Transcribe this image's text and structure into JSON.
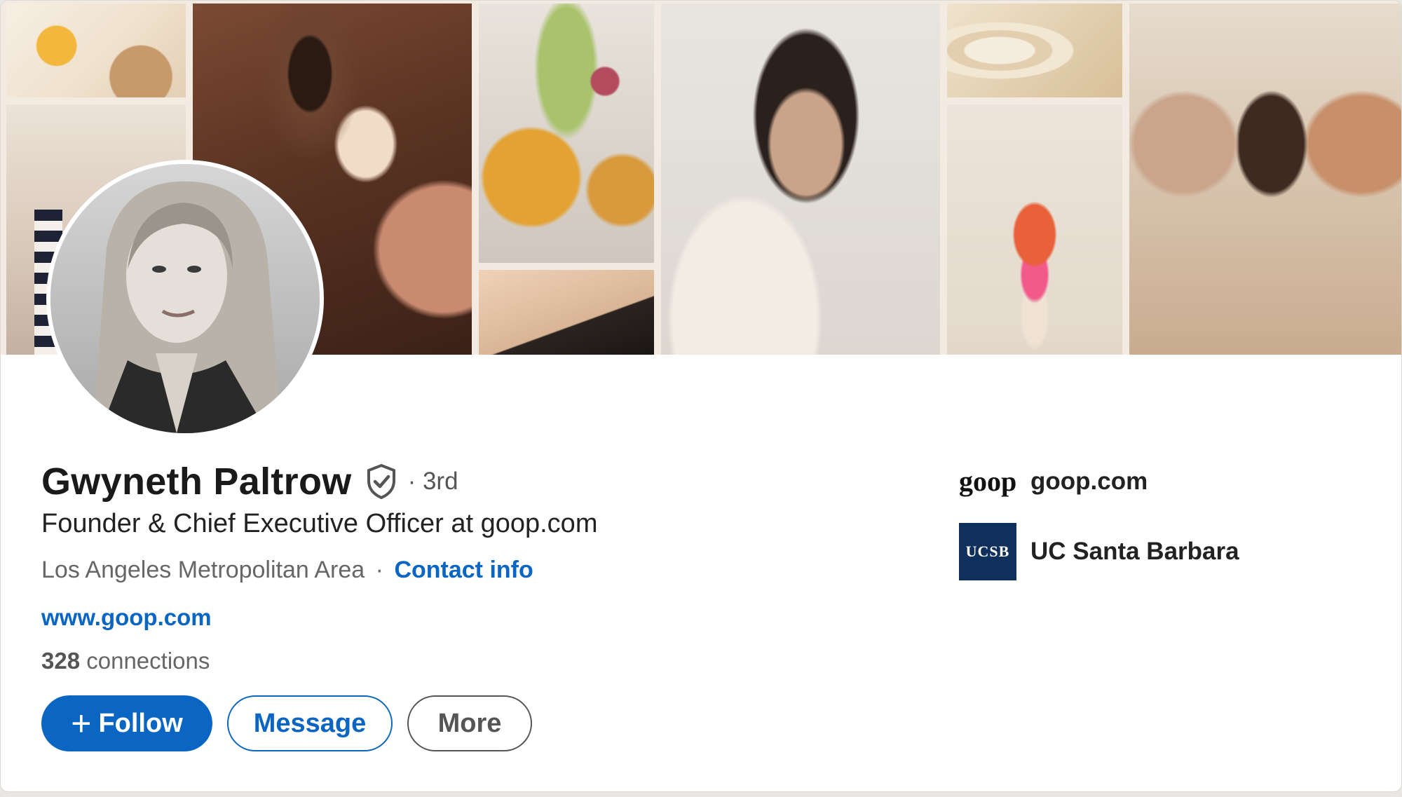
{
  "profile": {
    "name": "Gwyneth Paltrow",
    "degree": "· 3rd",
    "headline": "Founder & Chief Executive Officer at goop.com",
    "location": "Los Angeles Metropolitan Area",
    "location_separator": "·",
    "contact_info_label": "Contact info",
    "website": "www.goop.com",
    "connections_count": "328",
    "connections_label": "connections"
  },
  "actions": {
    "follow_plus": "+",
    "follow_label": "Follow",
    "message_label": "Message",
    "more_label": "More"
  },
  "organizations": [
    {
      "logo_text": "goop",
      "name": "goop.com"
    },
    {
      "logo_text": "UCSB",
      "name": "UC Santa Barbara"
    }
  ],
  "colors": {
    "primary_blue": "#0a66c2",
    "ucsb_navy": "#0f2f5c"
  },
  "icons": {
    "verified": "verified-shield-check-icon"
  }
}
